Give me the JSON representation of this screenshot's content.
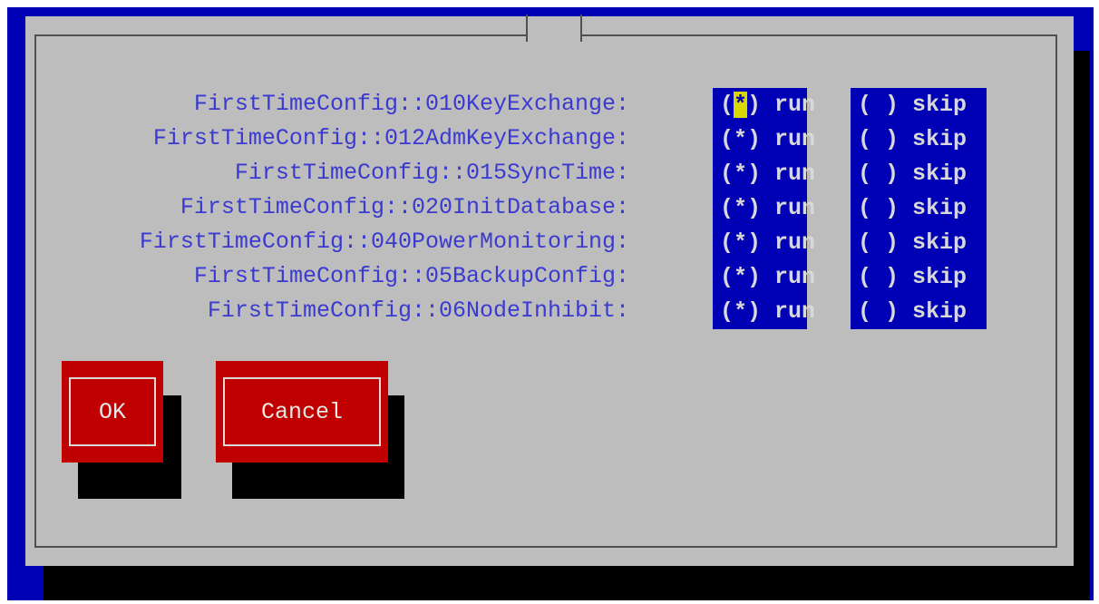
{
  "dialog": {
    "options": [
      {
        "label": "FirstTimeConfig::010KeyExchange:",
        "run_text": "(*) run",
        "skip_text": "( ) skip"
      },
      {
        "label": "FirstTimeConfig::012AdmKeyExchange:",
        "run_text": "(*) run",
        "skip_text": "( ) skip"
      },
      {
        "label": "FirstTimeConfig::015SyncTime:",
        "run_text": "(*) run",
        "skip_text": "( ) skip"
      },
      {
        "label": "FirstTimeConfig::020InitDatabase:",
        "run_text": "(*) run",
        "skip_text": "( ) skip"
      },
      {
        "label": "FirstTimeConfig::040PowerMonitoring:",
        "run_text": "(*) run",
        "skip_text": "( ) skip"
      },
      {
        "label": "FirstTimeConfig::05BackupConfig:",
        "run_text": "(*) run",
        "skip_text": "( ) skip"
      },
      {
        "label": "FirstTimeConfig::06NodeInhibit:",
        "run_text": "(*) run",
        "skip_text": "( ) skip"
      }
    ],
    "buttons": {
      "ok_label": "OK",
      "cancel_label": "Cancel"
    }
  },
  "colors": {
    "screen_bg": "#0000b4",
    "dialog_bg": "#bdbdbd",
    "label_text": "#3a3ad0",
    "radio_bg": "#0000b4",
    "button_bg": "#c00000",
    "cursor_bg": "#d8d800"
  }
}
